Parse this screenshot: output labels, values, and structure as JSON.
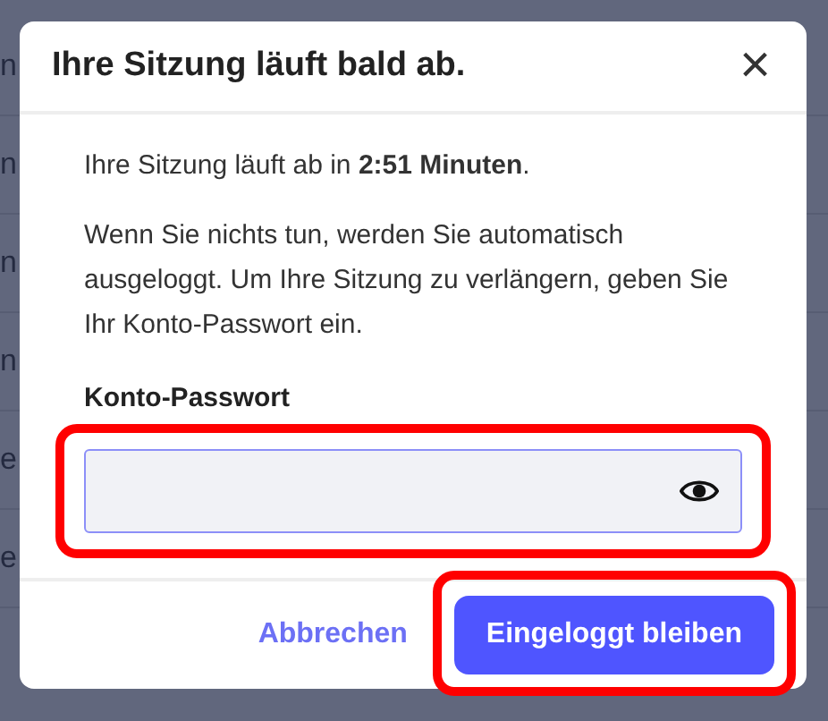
{
  "background_rows": [
    "n",
    "n",
    "n",
    "n",
    "e",
    "e"
  ],
  "dialog": {
    "title": "Ihre Sitzung läuft bald ab.",
    "close": "×",
    "message": "Ihre Sitzung läuft ab in **2:51 Minuten**.",
    "explanation": "Wenn Sie nichts tun, werden Sie automatisch ausgeloggt. Um Ihre Sitzung zu verlängern, geben Sie Ihr Konto-Passwort ein.",
    "field": {
      "label": "Konto-Passwort",
      "highlighted": true
    },
    "buttons": [
      {
        "label": "Abbrechen",
        "kind": "link",
        "highlighted": false
      },
      {
        "label": "Eingeloggt bleiben",
        "kind": "primary",
        "highlighted": true
      }
    ]
  }
}
